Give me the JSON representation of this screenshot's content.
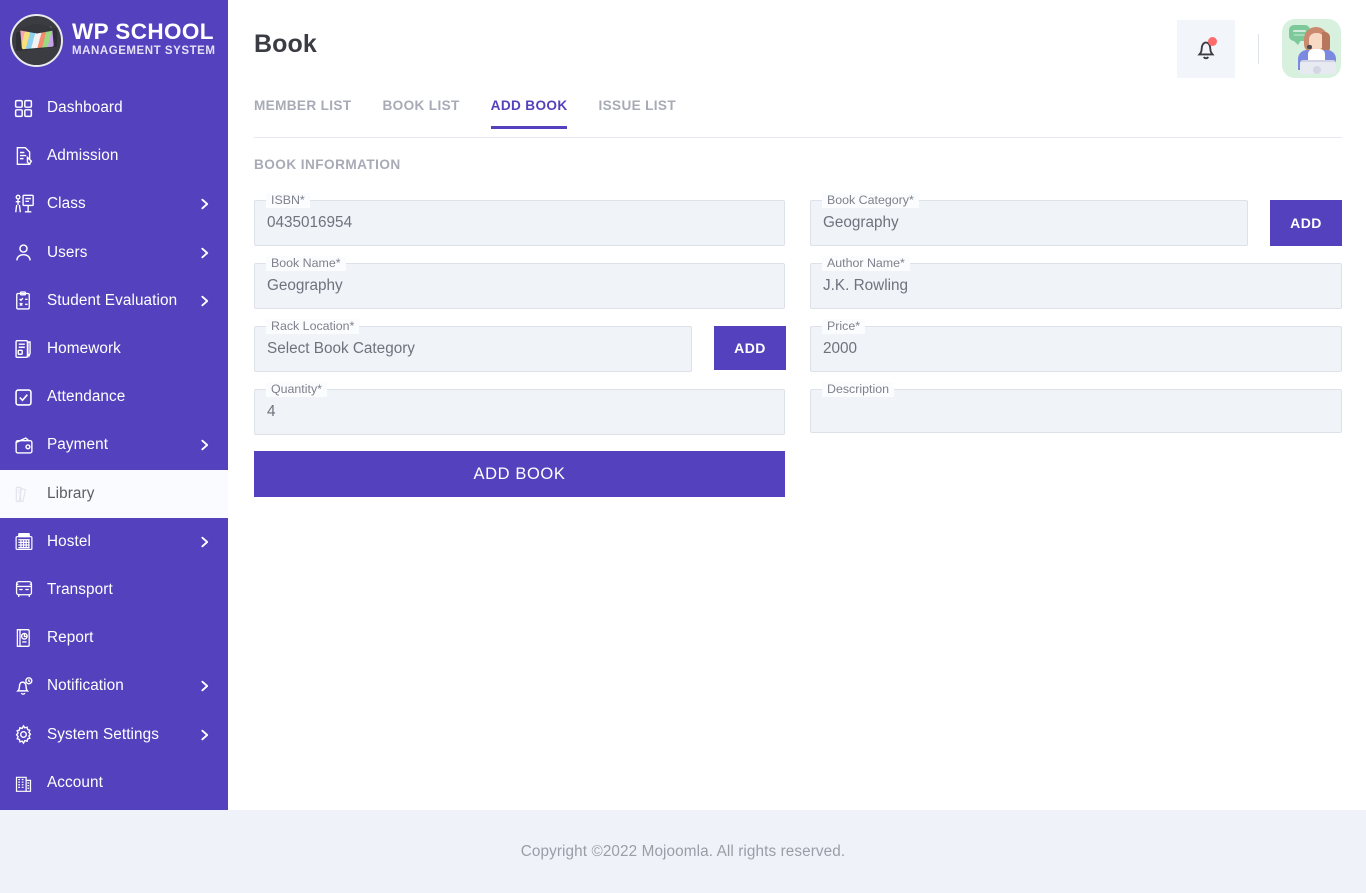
{
  "brand": {
    "name": "WP SCHOOL",
    "subtitle": "MANAGEMENT SYSTEM",
    "logo_icon": "graduation-cap-logo"
  },
  "colors": {
    "sidebar_bg": "#5441BD",
    "accent": "#5441BD",
    "field_bg": "#f0f3f8",
    "field_border": "#dde2ea",
    "footer_bg": "#eff3f9",
    "notification_dot": "#ff6b6b",
    "avatar_bg": "#d8f0de",
    "muted_text": "#a8abb6"
  },
  "sidebar": {
    "items": [
      {
        "label": "Dashboard",
        "icon": "grid-dashboard-icon",
        "has_caret": false,
        "active": false
      },
      {
        "label": "Admission",
        "icon": "document-pen-icon",
        "has_caret": false,
        "active": false
      },
      {
        "label": "Class",
        "icon": "teacher-board-icon",
        "has_caret": true,
        "active": false
      },
      {
        "label": "Users",
        "icon": "user-icon",
        "has_caret": true,
        "active": false
      },
      {
        "label": "Student Evaluation",
        "icon": "clipboard-check-icon",
        "has_caret": true,
        "active": false
      },
      {
        "label": "Homework",
        "icon": "notebook-pencil-icon",
        "has_caret": false,
        "active": false
      },
      {
        "label": "Attendance",
        "icon": "checkbox-square-icon",
        "has_caret": false,
        "active": false
      },
      {
        "label": "Payment",
        "icon": "wallet-icon",
        "has_caret": true,
        "active": false
      },
      {
        "label": "Library",
        "icon": "books-icon",
        "has_caret": false,
        "active": true
      },
      {
        "label": "Hostel",
        "icon": "hostel-building-icon",
        "has_caret": true,
        "active": false
      },
      {
        "label": "Transport",
        "icon": "bus-icon",
        "has_caret": false,
        "active": false
      },
      {
        "label": "Report",
        "icon": "report-chart-icon",
        "has_caret": false,
        "active": false
      },
      {
        "label": "Notification",
        "icon": "bell-clock-icon",
        "has_caret": true,
        "active": false
      },
      {
        "label": "System Settings",
        "icon": "gear-icon",
        "has_caret": true,
        "active": false
      },
      {
        "label": "Account",
        "icon": "building-account-icon",
        "has_caret": false,
        "active": false
      }
    ]
  },
  "header": {
    "title": "Book",
    "bell_icon": "bell-icon",
    "has_notification": true,
    "avatar_icon": "support-agent-avatar"
  },
  "tabs": [
    {
      "label": "MEMBER LIST",
      "active": false
    },
    {
      "label": "BOOK LIST",
      "active": false
    },
    {
      "label": "ADD BOOK",
      "active": true
    },
    {
      "label": "ISSUE LIST",
      "active": false
    }
  ],
  "form": {
    "section_title": "BOOK INFORMATION",
    "fields": {
      "isbn": {
        "label": "ISBN*",
        "value": "0435016954"
      },
      "book_category": {
        "label": "Book Category*",
        "value": "Geography"
      },
      "book_name": {
        "label": "Book Name*",
        "value": "Geography"
      },
      "author_name": {
        "label": "Author Name*",
        "value": "J.K. Rowling"
      },
      "rack_location": {
        "label": "Rack Location*",
        "value": "Select Book Category"
      },
      "price": {
        "label": "Price*",
        "value": "2000"
      },
      "quantity": {
        "label": "Quantity*",
        "value": "4"
      },
      "description": {
        "label": "Description",
        "value": ""
      }
    },
    "add_category_label": "ADD",
    "add_rack_label": "ADD",
    "submit_label": "ADD BOOK"
  },
  "footer": {
    "text": "Copyright ©2022 Mojoomla. All rights reserved."
  }
}
